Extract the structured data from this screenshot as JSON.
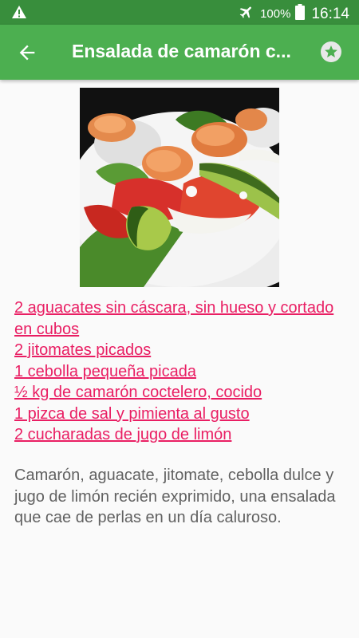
{
  "status_bar": {
    "battery_percent": "100%",
    "time": "16:14",
    "icons": [
      "warning-icon",
      "airplane-mode-icon",
      "battery-icon"
    ]
  },
  "app_bar": {
    "title": "Ensalada de camarón c...",
    "icons": [
      "back-arrow-icon",
      "star-icon"
    ]
  },
  "recipe": {
    "image": "shrimp avocado tomato salad photo",
    "ingredients": [
      "2 aguacates sin cáscara, sin hueso y cortado en cubos",
      "2 jitomates picados",
      "1 cebolla pequeña picada",
      "½ kg de camarón coctelero, cocido",
      "1 pizca de sal y pimienta al gusto",
      "2 cucharadas de jugo de limón"
    ],
    "description": "Camarón, aguacate, jitomate, cebolla dulce y jugo de limón recién exprimido, una ensalada que cae de perlas en un día caluroso."
  },
  "colors": {
    "status_bar": "#388e3c",
    "app_bar": "#4caf50",
    "ingredient_link": "#e91e63",
    "description_text": "#616161"
  }
}
